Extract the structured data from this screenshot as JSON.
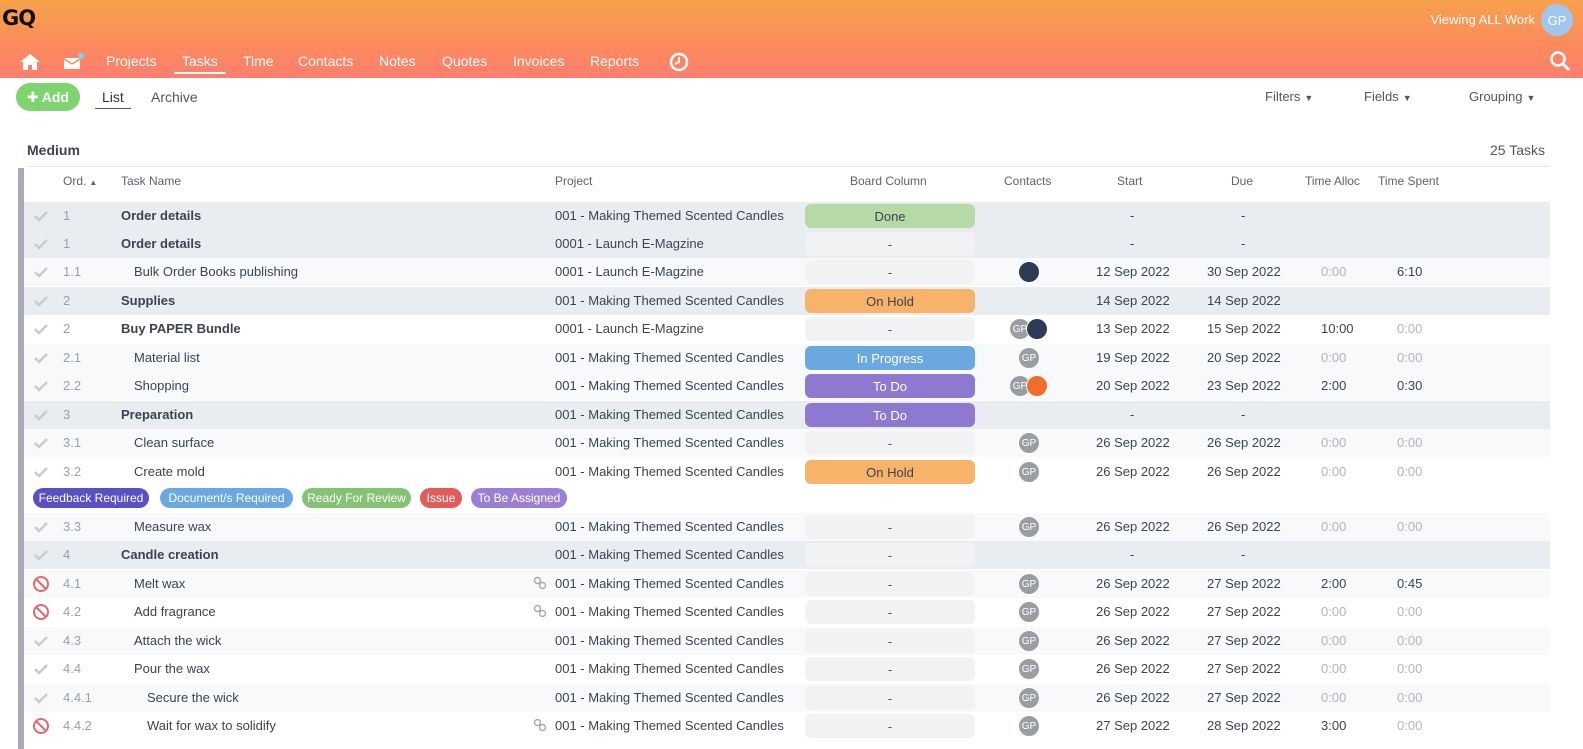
{
  "header": {
    "logo": "GQ",
    "viewing": "Viewing ALL Work",
    "avatar": "GP",
    "nav": [
      "Projects",
      "Tasks",
      "Time",
      "Contacts",
      "Notes",
      "Quotes",
      "Invoices",
      "Reports"
    ],
    "active_nav": "Tasks"
  },
  "toolbar": {
    "add_label": "Add",
    "tabs": [
      "List",
      "Archive"
    ],
    "filters": "Filters",
    "fields": "Fields",
    "grouping": "Grouping"
  },
  "group": {
    "title": "Medium",
    "count": "25 Tasks"
  },
  "columns": {
    "ord": "Ord.",
    "task_name": "Task Name",
    "project": "Project",
    "board": "Board Column",
    "contacts": "Contacts",
    "start": "Start",
    "due": "Due",
    "time_alloc": "Time Alloc",
    "time_spent": "Time Spent"
  },
  "tags": [
    "Feedback Required",
    "Document/s Required",
    "Ready For Review",
    "Issue",
    "To Be Assigned"
  ],
  "tag_colors": [
    "#5b4fc4",
    "#6ba8e0",
    "#86c274",
    "#e25c5c",
    "#9b7fd4"
  ],
  "rows": [
    {
      "ord": "1",
      "name": "Order details",
      "project": "001 - Making Themed Scented Candles",
      "board": "Done",
      "contacts": [],
      "start": "-",
      "due": "-",
      "alloc": "",
      "spent": ""
    },
    {
      "ord": "1",
      "name": "Order details",
      "project": "0001 - Launch E-Magzine",
      "board": "-",
      "contacts": [],
      "start": "-",
      "due": "-",
      "alloc": "",
      "spent": ""
    },
    {
      "ord": "1.1",
      "name": "Bulk Order Books publishing",
      "project": "0001 - Launch E-Magzine",
      "board": "-",
      "contacts": [
        "photo"
      ],
      "start": "12 Sep 2022",
      "due": "30 Sep 2022",
      "alloc": "0:00",
      "spent": "6:10"
    },
    {
      "ord": "2",
      "name": "Supplies",
      "project": "001 - Making Themed Scented Candles",
      "board": "On Hold",
      "contacts": [],
      "start": "14 Sep 2022",
      "due": "14 Sep 2022",
      "alloc": "",
      "spent": ""
    },
    {
      "ord": "2",
      "name": "Buy PAPER Bundle",
      "project": "0001 - Launch E-Magzine",
      "board": "-",
      "contacts": [
        "GP",
        "photo"
      ],
      "start": "13 Sep 2022",
      "due": "15 Sep 2022",
      "alloc": "10:00",
      "spent": "0:00"
    },
    {
      "ord": "2.1",
      "name": "Material list",
      "project": "001 - Making Themed Scented Candles",
      "board": "In Progress",
      "contacts": [
        "GP"
      ],
      "start": "19 Sep 2022",
      "due": "20 Sep 2022",
      "alloc": "0:00",
      "spent": "0:00"
    },
    {
      "ord": "2.2",
      "name": "Shopping",
      "project": "001 - Making Themed Scented Candles",
      "board": "To Do",
      "contacts": [
        "GP",
        "orange"
      ],
      "start": "20 Sep 2022",
      "due": "23 Sep 2022",
      "alloc": "2:00",
      "spent": "0:30"
    },
    {
      "ord": "3",
      "name": "Preparation",
      "project": "001 - Making Themed Scented Candles",
      "board": "To Do",
      "contacts": [],
      "start": "-",
      "due": "-",
      "alloc": "",
      "spent": ""
    },
    {
      "ord": "3.1",
      "name": "Clean surface",
      "project": "001 - Making Themed Scented Candles",
      "board": "-",
      "contacts": [
        "GP"
      ],
      "start": "26 Sep 2022",
      "due": "26 Sep 2022",
      "alloc": "0:00",
      "spent": "0:00"
    },
    {
      "ord": "3.2",
      "name": "Create mold",
      "project": "001 - Making Themed Scented Candles",
      "board": "On Hold",
      "contacts": [
        "GP"
      ],
      "start": "26 Sep 2022",
      "due": "26 Sep 2022",
      "alloc": "0:00",
      "spent": "0:00"
    },
    {
      "ord": "3.3",
      "name": "Measure wax",
      "project": "001 - Making Themed Scented Candles",
      "board": "-",
      "contacts": [
        "GP"
      ],
      "start": "26 Sep 2022",
      "due": "26 Sep 2022",
      "alloc": "0:00",
      "spent": "0:00"
    },
    {
      "ord": "4",
      "name": "Candle creation",
      "project": "001 - Making Themed Scented Candles",
      "board": "-",
      "contacts": [],
      "start": "-",
      "due": "-",
      "alloc": "",
      "spent": ""
    },
    {
      "ord": "4.1",
      "name": "Melt wax",
      "project": "001 - Making Themed Scented Candles",
      "board": "-",
      "contacts": [
        "GP"
      ],
      "start": "26 Sep 2022",
      "due": "27 Sep 2022",
      "alloc": "2:00",
      "spent": "0:45"
    },
    {
      "ord": "4.2",
      "name": "Add fragrance",
      "project": "001 - Making Themed Scented Candles",
      "board": "-",
      "contacts": [
        "GP"
      ],
      "start": "26 Sep 2022",
      "due": "27 Sep 2022",
      "alloc": "0:00",
      "spent": "0:00"
    },
    {
      "ord": "4.3",
      "name": "Attach the wick",
      "project": "001 - Making Themed Scented Candles",
      "board": "-",
      "contacts": [
        "GP"
      ],
      "start": "26 Sep 2022",
      "due": "27 Sep 2022",
      "alloc": "0:00",
      "spent": "0:00"
    },
    {
      "ord": "4.4",
      "name": "Pour the wax",
      "project": "001 - Making Themed Scented Candles",
      "board": "-",
      "contacts": [
        "GP"
      ],
      "start": "26 Sep 2022",
      "due": "27 Sep 2022",
      "alloc": "0:00",
      "spent": "0:00"
    },
    {
      "ord": "4.4.1",
      "name": "Secure the wick",
      "project": "001 - Making Themed Scented Candles",
      "board": "-",
      "contacts": [
        "GP"
      ],
      "start": "26 Sep 2022",
      "due": "27 Sep 2022",
      "alloc": "0:00",
      "spent": "0:00"
    },
    {
      "ord": "4.4.2",
      "name": "Wait for wax to solidify",
      "project": "001 - Making Themed Scented Candles",
      "board": "-",
      "contacts": [
        "GP"
      ],
      "start": "27 Sep 2022",
      "due": "28 Sep 2022",
      "alloc": "3:00",
      "spent": "0:00"
    }
  ]
}
